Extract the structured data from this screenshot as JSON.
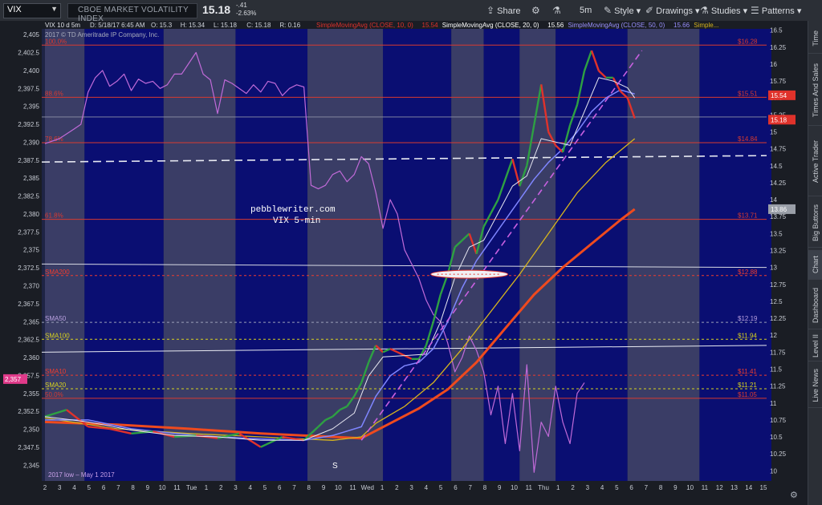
{
  "toolbar": {
    "symbol": "VIX",
    "description": "CBOE MARKET VOLATILITY INDEX",
    "last": "15.18",
    "change": "-.41",
    "change_pct": "-2.63%",
    "share_label": "Share",
    "timeframe_label": "5m",
    "style_label": "Style",
    "drawings_label": "Drawings",
    "studies_label": "Studies",
    "patterns_label": "Patterns"
  },
  "sidebar": {
    "tabs": [
      "Time",
      "Times And Sales",
      "Active Trader",
      "Big Buttons",
      "Chart",
      "Dashboard",
      "Level II",
      "Live News"
    ],
    "active": "Chart"
  },
  "colors": {
    "background": "#1e2445",
    "band_dark": "#0a0e72",
    "band_light": "#3a3d66",
    "price_up": "#2ea043",
    "price_down": "#e0322b",
    "sma10": "#e8e8f2",
    "sma20": "#7f86ff",
    "sma50": "#d7b51e",
    "sma200": "#ef4a1e",
    "overlay": "#c06ad8",
    "fib": "#d83a30",
    "trend": "#c860e0"
  },
  "chart_data": {
    "type": "line",
    "header": {
      "title": "VIX 10 d 5m",
      "date": "D: 5/18/17 6:45 AM",
      "ohlc": [
        "O: 15.3",
        "H: 15.34",
        "L: 15.18",
        "C: 15.18",
        "R: 0.16"
      ],
      "studies": [
        "SimpleMovingAvg (CLOSE, 10, 0)",
        "15.54",
        "SimpleMovingAvg (CLOSE, 20, 0)",
        "15.56",
        "SimpleMovingAvg (CLOSE, 50, 0)",
        "15.66",
        "Simple..."
      ],
      "copyright": "2017 © TD Ameritrade IP Company, Inc."
    },
    "annotations": [
      "pebblewriter.com",
      "VIX 5-min",
      "2017 low – May 1 2017",
      "S"
    ],
    "y_right": {
      "min": 9.85,
      "max": 16.52,
      "ticks": [
        16.5,
        16.25,
        16,
        15.75,
        15.5,
        15.25,
        15,
        14.75,
        14.5,
        14.25,
        14,
        13.75,
        13.5,
        13.25,
        13,
        12.75,
        12.5,
        12.25,
        12,
        11.75,
        11.5,
        11.25,
        11,
        10.75,
        10.5,
        10.25,
        10
      ]
    },
    "y_left": {
      "min": 2342.8,
      "max": 2405.8,
      "ticks": [
        "2,405",
        "2,402.5",
        "2,400",
        "2,397.5",
        "2,395",
        "2,392.5",
        "2,390",
        "2,387.5",
        "2,385",
        "2,382.5",
        "2,380",
        "2,377.5",
        "2,375",
        "2,372.5",
        "2,370",
        "2,367.5",
        "2,365",
        "2,362.5",
        "2,360",
        "2,357.5",
        "2,355",
        "2,352.5",
        "2,350",
        "2,347.5",
        "2,345"
      ]
    },
    "x_ticks": [
      "2",
      "3",
      "4",
      "5",
      "6",
      "7",
      "8",
      "9",
      "10",
      "11",
      "Tue",
      "1",
      "2",
      "3",
      "4",
      "5",
      "6",
      "7",
      "8",
      "9",
      "10",
      "11",
      "Wed",
      "1",
      "2",
      "3",
      "4",
      "5",
      "6",
      "7",
      "8",
      "9",
      "10",
      "11",
      "Thu",
      "1",
      "2",
      "3",
      "4",
      "5",
      "6",
      "7",
      "8",
      "9",
      "10",
      "11",
      "12",
      "13",
      "14",
      "15"
    ],
    "sessions": [
      {
        "start": 0,
        "end": 5.5,
        "shade": "light"
      },
      {
        "start": 5.5,
        "end": 16.5,
        "shade": "dark"
      },
      {
        "start": 16.5,
        "end": 26.5,
        "shade": "light"
      },
      {
        "start": 26.5,
        "end": 36.5,
        "shade": "dark"
      },
      {
        "start": 36.5,
        "end": 47,
        "shade": "light"
      },
      {
        "start": 47,
        "end": 56.5,
        "shade": "dark"
      },
      {
        "start": 56.5,
        "end": 61,
        "shade": "light"
      },
      {
        "start": 61,
        "end": 66,
        "shade": "dark"
      },
      {
        "start": 66,
        "end": 71,
        "shade": "light"
      },
      {
        "start": 71,
        "end": 81,
        "shade": "dark"
      },
      {
        "start": 81,
        "end": 91,
        "shade": "light"
      },
      {
        "start": 91,
        "end": 101,
        "shade": "dark"
      }
    ],
    "levels": [
      {
        "label": "100.0%",
        "value": 16.28,
        "value_label": "$16.28",
        "color": "#d83a30",
        "style": "solid"
      },
      {
        "label": "88.6%",
        "value": 15.51,
        "value_label": "$15.51",
        "color": "#d83a30",
        "style": "solid"
      },
      {
        "label": "78.6%",
        "value": 14.84,
        "value_label": "$14.84",
        "color": "#d83a30",
        "style": "solid"
      },
      {
        "label": "61.8%",
        "value": 13.71,
        "value_label": "$13.71",
        "color": "#d83a30",
        "style": "solid"
      },
      {
        "label": "SMA200",
        "value": 12.88,
        "value_label": "$12.88",
        "color": "#ef3d2e",
        "style": "dashed"
      },
      {
        "label": "SMA50",
        "value": 12.19,
        "value_label": "$12.19",
        "color": "#9aa0b8",
        "style": "dashed"
      },
      {
        "label": "SMA100",
        "value": 11.94,
        "value_label": "$11.94",
        "color": "#d7d21e",
        "style": "dashed"
      },
      {
        "label": "SMA10",
        "value": 11.41,
        "value_label": "$11.41",
        "color": "#ef3d2e",
        "style": "dashed"
      },
      {
        "label": "SMA20",
        "value": 11.21,
        "value_label": "$11.21",
        "color": "#d7d21e",
        "style": "dashed"
      },
      {
        "label": "50.0%",
        "value": 11.07,
        "value_label": "$11.05",
        "color": "#d83a30",
        "style": "solid"
      }
    ],
    "last_labels": [
      {
        "text": "15.54",
        "value": 15.54,
        "color": "#e0322b"
      },
      {
        "text": "15.18",
        "value": 15.18,
        "color": "#e0322b"
      },
      {
        "text": "13.86",
        "value": 13.86,
        "color": "#9a9fa8"
      }
    ],
    "left_marker": {
      "text": "2,357",
      "value": 2357
    },
    "white_level": {
      "value": 14.65,
      "style": "dashed"
    },
    "price": [
      [
        0,
        10.8
      ],
      [
        3,
        10.9
      ],
      [
        6,
        10.65
      ],
      [
        9,
        10.62
      ],
      [
        12,
        10.55
      ],
      [
        15,
        10.58
      ],
      [
        18,
        10.5
      ],
      [
        21,
        10.52
      ],
      [
        24,
        10.48
      ],
      [
        27,
        10.55
      ],
      [
        30,
        10.35
      ],
      [
        33,
        10.5
      ],
      [
        36,
        10.45
      ],
      [
        37,
        10.55
      ],
      [
        38,
        10.65
      ],
      [
        39,
        10.75
      ],
      [
        40,
        10.8
      ],
      [
        41,
        10.9
      ],
      [
        42,
        10.95
      ],
      [
        43,
        11.1
      ],
      [
        44,
        11.3
      ],
      [
        45,
        11.6
      ],
      [
        46,
        11.85
      ],
      [
        47,
        11.75
      ],
      [
        48,
        11.8
      ],
      [
        49,
        11.75
      ],
      [
        50,
        11.7
      ],
      [
        51,
        11.65
      ],
      [
        52,
        11.65
      ],
      [
        53,
        11.85
      ],
      [
        54,
        12.2
      ],
      [
        55,
        12.6
      ],
      [
        56,
        12.9
      ],
      [
        57,
        13.3
      ],
      [
        58,
        13.4
      ],
      [
        59,
        13.5
      ],
      [
        60,
        13.2
      ],
      [
        61,
        13.6
      ],
      [
        62,
        13.8
      ],
      [
        63,
        14.0
      ],
      [
        64,
        14.3
      ],
      [
        65,
        14.6
      ],
      [
        66,
        14.2
      ],
      [
        67,
        14.5
      ],
      [
        68,
        15.1
      ],
      [
        69,
        15.7
      ],
      [
        70,
        15.0
      ],
      [
        71,
        14.8
      ],
      [
        72,
        14.7
      ],
      [
        73,
        15.1
      ],
      [
        74,
        15.4
      ],
      [
        75,
        15.9
      ],
      [
        76,
        16.2
      ],
      [
        77,
        15.9
      ],
      [
        78,
        15.8
      ],
      [
        79,
        15.8
      ],
      [
        80,
        15.6
      ],
      [
        81,
        15.5
      ],
      [
        82,
        15.2
      ]
    ],
    "sma10": [
      [
        0,
        10.8
      ],
      [
        6,
        10.72
      ],
      [
        12,
        10.6
      ],
      [
        18,
        10.52
      ],
      [
        24,
        10.5
      ],
      [
        30,
        10.45
      ],
      [
        36,
        10.45
      ],
      [
        40,
        10.62
      ],
      [
        43,
        10.85
      ],
      [
        45,
        11.4
      ],
      [
        47,
        11.68
      ],
      [
        50,
        11.7
      ],
      [
        53,
        11.72
      ],
      [
        55,
        12.2
      ],
      [
        57,
        12.85
      ],
      [
        59,
        13.3
      ],
      [
        61,
        13.4
      ],
      [
        63,
        13.8
      ],
      [
        65,
        14.2
      ],
      [
        67,
        14.35
      ],
      [
        69,
        14.9
      ],
      [
        71,
        14.85
      ],
      [
        73,
        14.8
      ],
      [
        75,
        15.3
      ],
      [
        77,
        15.8
      ],
      [
        79,
        15.75
      ],
      [
        81,
        15.65
      ],
      [
        82,
        15.5
      ]
    ],
    "sma20": [
      [
        0,
        10.75
      ],
      [
        6,
        10.75
      ],
      [
        12,
        10.62
      ],
      [
        18,
        10.55
      ],
      [
        24,
        10.5
      ],
      [
        30,
        10.47
      ],
      [
        36,
        10.45
      ],
      [
        40,
        10.52
      ],
      [
        44,
        10.65
      ],
      [
        46,
        11.1
      ],
      [
        48,
        11.4
      ],
      [
        50,
        11.55
      ],
      [
        52,
        11.6
      ],
      [
        54,
        11.8
      ],
      [
        56,
        12.2
      ],
      [
        58,
        12.7
      ],
      [
        60,
        13.1
      ],
      [
        62,
        13.4
      ],
      [
        64,
        13.7
      ],
      [
        66,
        14.0
      ],
      [
        68,
        14.3
      ],
      [
        70,
        14.55
      ],
      [
        72,
        14.75
      ],
      [
        74,
        15.0
      ],
      [
        76,
        15.3
      ],
      [
        78,
        15.5
      ],
      [
        80,
        15.62
      ],
      [
        82,
        15.56
      ]
    ],
    "sma50": [
      [
        0,
        10.78
      ],
      [
        10,
        10.62
      ],
      [
        20,
        10.55
      ],
      [
        30,
        10.5
      ],
      [
        40,
        10.45
      ],
      [
        44,
        10.5
      ],
      [
        46,
        10.7
      ],
      [
        50,
        10.95
      ],
      [
        54,
        11.3
      ],
      [
        58,
        11.8
      ],
      [
        62,
        12.35
      ],
      [
        66,
        12.9
      ],
      [
        70,
        13.5
      ],
      [
        74,
        14.1
      ],
      [
        78,
        14.55
      ],
      [
        82,
        14.9
      ]
    ],
    "sma200": [
      [
        0,
        10.72
      ],
      [
        10,
        10.68
      ],
      [
        20,
        10.62
      ],
      [
        30,
        10.55
      ],
      [
        40,
        10.5
      ],
      [
        44,
        10.48
      ],
      [
        48,
        10.7
      ],
      [
        52,
        10.92
      ],
      [
        56,
        11.2
      ],
      [
        60,
        11.6
      ],
      [
        64,
        12.1
      ],
      [
        68,
        12.6
      ],
      [
        72,
        13.0
      ],
      [
        76,
        13.35
      ],
      [
        80,
        13.7
      ],
      [
        82,
        13.86
      ]
    ],
    "overlay_es": [
      [
        0,
        2389.8
      ],
      [
        2,
        2390.5
      ],
      [
        4,
        2391.8
      ],
      [
        5,
        2392.5
      ],
      [
        6,
        2397
      ],
      [
        7,
        2399
      ],
      [
        8,
        2400
      ],
      [
        9,
        2397.8
      ],
      [
        10,
        2398.5
      ],
      [
        11,
        2399.5
      ],
      [
        12,
        2397.2
      ],
      [
        13,
        2398.8
      ],
      [
        14,
        2398.2
      ],
      [
        15,
        2398.5
      ],
      [
        16,
        2397.5
      ],
      [
        17,
        2398
      ],
      [
        18,
        2399.5
      ],
      [
        19,
        2399.5
      ],
      [
        20,
        2401
      ],
      [
        21,
        2402.5
      ],
      [
        22,
        2399.5
      ],
      [
        23,
        2398.7
      ],
      [
        24,
        2394
      ],
      [
        25,
        2398.7
      ],
      [
        26,
        2398.2
      ],
      [
        27,
        2397.5
      ],
      [
        28,
        2396.8
      ],
      [
        29,
        2398
      ],
      [
        30,
        2397
      ],
      [
        31,
        2398.5
      ],
      [
        32,
        2398.2
      ],
      [
        33,
        2396.5
      ],
      [
        34,
        2397.5
      ],
      [
        35,
        2398
      ],
      [
        36,
        2397.7
      ],
      [
        37,
        2384
      ],
      [
        38,
        2383.5
      ],
      [
        39,
        2384
      ],
      [
        40,
        2385.5
      ],
      [
        41,
        2386
      ],
      [
        42,
        2384.5
      ],
      [
        43,
        2385.5
      ],
      [
        44,
        2388
      ],
      [
        45,
        2387
      ],
      [
        46,
        2383
      ],
      [
        47,
        2378
      ],
      [
        48,
        2382
      ],
      [
        49,
        2380
      ],
      [
        50,
        2375
      ],
      [
        51,
        2373
      ],
      [
        52,
        2371
      ],
      [
        53,
        2368
      ],
      [
        54,
        2366
      ],
      [
        55,
        2365
      ],
      [
        56,
        2362
      ],
      [
        57,
        2358
      ],
      [
        58,
        2360
      ],
      [
        59,
        2363
      ],
      [
        60,
        2361
      ],
      [
        61,
        2358
      ],
      [
        62,
        2352
      ],
      [
        63,
        2356
      ],
      [
        64,
        2348
      ],
      [
        65,
        2355
      ],
      [
        66,
        2347
      ],
      [
        67,
        2359
      ],
      [
        68,
        2344
      ],
      [
        69,
        2351
      ],
      [
        70,
        2349
      ],
      [
        71,
        2356
      ],
      [
        72,
        2351
      ],
      [
        73,
        2348
      ],
      [
        74,
        2355
      ],
      [
        75,
        2356.5
      ]
    ],
    "trend_line": [
      [
        44,
        10.45
      ],
      [
        83,
        16.2
      ]
    ]
  }
}
